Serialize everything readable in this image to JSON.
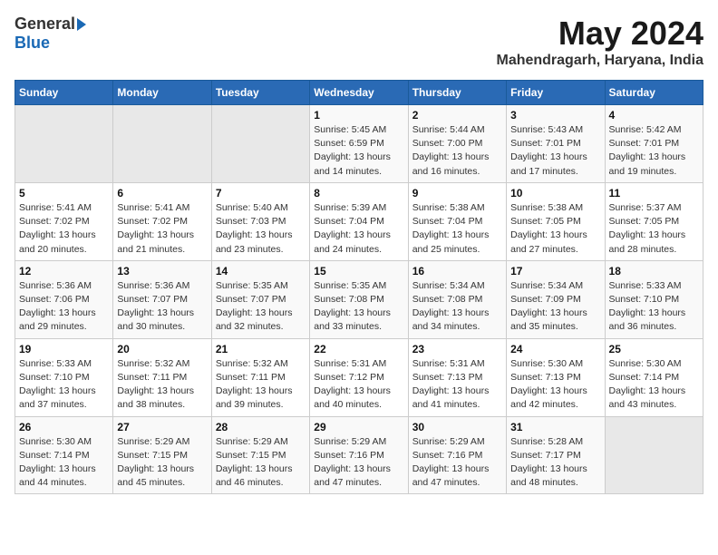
{
  "header": {
    "logo_general": "General",
    "logo_blue": "Blue",
    "month_year": "May 2024",
    "location": "Mahendragarh, Haryana, India"
  },
  "days_of_week": [
    "Sunday",
    "Monday",
    "Tuesday",
    "Wednesday",
    "Thursday",
    "Friday",
    "Saturday"
  ],
  "weeks": [
    [
      {
        "num": "",
        "info": ""
      },
      {
        "num": "",
        "info": ""
      },
      {
        "num": "",
        "info": ""
      },
      {
        "num": "1",
        "info": "Sunrise: 5:45 AM\nSunset: 6:59 PM\nDaylight: 13 hours\nand 14 minutes."
      },
      {
        "num": "2",
        "info": "Sunrise: 5:44 AM\nSunset: 7:00 PM\nDaylight: 13 hours\nand 16 minutes."
      },
      {
        "num": "3",
        "info": "Sunrise: 5:43 AM\nSunset: 7:01 PM\nDaylight: 13 hours\nand 17 minutes."
      },
      {
        "num": "4",
        "info": "Sunrise: 5:42 AM\nSunset: 7:01 PM\nDaylight: 13 hours\nand 19 minutes."
      }
    ],
    [
      {
        "num": "5",
        "info": "Sunrise: 5:41 AM\nSunset: 7:02 PM\nDaylight: 13 hours\nand 20 minutes."
      },
      {
        "num": "6",
        "info": "Sunrise: 5:41 AM\nSunset: 7:02 PM\nDaylight: 13 hours\nand 21 minutes."
      },
      {
        "num": "7",
        "info": "Sunrise: 5:40 AM\nSunset: 7:03 PM\nDaylight: 13 hours\nand 23 minutes."
      },
      {
        "num": "8",
        "info": "Sunrise: 5:39 AM\nSunset: 7:04 PM\nDaylight: 13 hours\nand 24 minutes."
      },
      {
        "num": "9",
        "info": "Sunrise: 5:38 AM\nSunset: 7:04 PM\nDaylight: 13 hours\nand 25 minutes."
      },
      {
        "num": "10",
        "info": "Sunrise: 5:38 AM\nSunset: 7:05 PM\nDaylight: 13 hours\nand 27 minutes."
      },
      {
        "num": "11",
        "info": "Sunrise: 5:37 AM\nSunset: 7:05 PM\nDaylight: 13 hours\nand 28 minutes."
      }
    ],
    [
      {
        "num": "12",
        "info": "Sunrise: 5:36 AM\nSunset: 7:06 PM\nDaylight: 13 hours\nand 29 minutes."
      },
      {
        "num": "13",
        "info": "Sunrise: 5:36 AM\nSunset: 7:07 PM\nDaylight: 13 hours\nand 30 minutes."
      },
      {
        "num": "14",
        "info": "Sunrise: 5:35 AM\nSunset: 7:07 PM\nDaylight: 13 hours\nand 32 minutes."
      },
      {
        "num": "15",
        "info": "Sunrise: 5:35 AM\nSunset: 7:08 PM\nDaylight: 13 hours\nand 33 minutes."
      },
      {
        "num": "16",
        "info": "Sunrise: 5:34 AM\nSunset: 7:08 PM\nDaylight: 13 hours\nand 34 minutes."
      },
      {
        "num": "17",
        "info": "Sunrise: 5:34 AM\nSunset: 7:09 PM\nDaylight: 13 hours\nand 35 minutes."
      },
      {
        "num": "18",
        "info": "Sunrise: 5:33 AM\nSunset: 7:10 PM\nDaylight: 13 hours\nand 36 minutes."
      }
    ],
    [
      {
        "num": "19",
        "info": "Sunrise: 5:33 AM\nSunset: 7:10 PM\nDaylight: 13 hours\nand 37 minutes."
      },
      {
        "num": "20",
        "info": "Sunrise: 5:32 AM\nSunset: 7:11 PM\nDaylight: 13 hours\nand 38 minutes."
      },
      {
        "num": "21",
        "info": "Sunrise: 5:32 AM\nSunset: 7:11 PM\nDaylight: 13 hours\nand 39 minutes."
      },
      {
        "num": "22",
        "info": "Sunrise: 5:31 AM\nSunset: 7:12 PM\nDaylight: 13 hours\nand 40 minutes."
      },
      {
        "num": "23",
        "info": "Sunrise: 5:31 AM\nSunset: 7:13 PM\nDaylight: 13 hours\nand 41 minutes."
      },
      {
        "num": "24",
        "info": "Sunrise: 5:30 AM\nSunset: 7:13 PM\nDaylight: 13 hours\nand 42 minutes."
      },
      {
        "num": "25",
        "info": "Sunrise: 5:30 AM\nSunset: 7:14 PM\nDaylight: 13 hours\nand 43 minutes."
      }
    ],
    [
      {
        "num": "26",
        "info": "Sunrise: 5:30 AM\nSunset: 7:14 PM\nDaylight: 13 hours\nand 44 minutes."
      },
      {
        "num": "27",
        "info": "Sunrise: 5:29 AM\nSunset: 7:15 PM\nDaylight: 13 hours\nand 45 minutes."
      },
      {
        "num": "28",
        "info": "Sunrise: 5:29 AM\nSunset: 7:15 PM\nDaylight: 13 hours\nand 46 minutes."
      },
      {
        "num": "29",
        "info": "Sunrise: 5:29 AM\nSunset: 7:16 PM\nDaylight: 13 hours\nand 47 minutes."
      },
      {
        "num": "30",
        "info": "Sunrise: 5:29 AM\nSunset: 7:16 PM\nDaylight: 13 hours\nand 47 minutes."
      },
      {
        "num": "31",
        "info": "Sunrise: 5:28 AM\nSunset: 7:17 PM\nDaylight: 13 hours\nand 48 minutes."
      },
      {
        "num": "",
        "info": ""
      }
    ]
  ]
}
